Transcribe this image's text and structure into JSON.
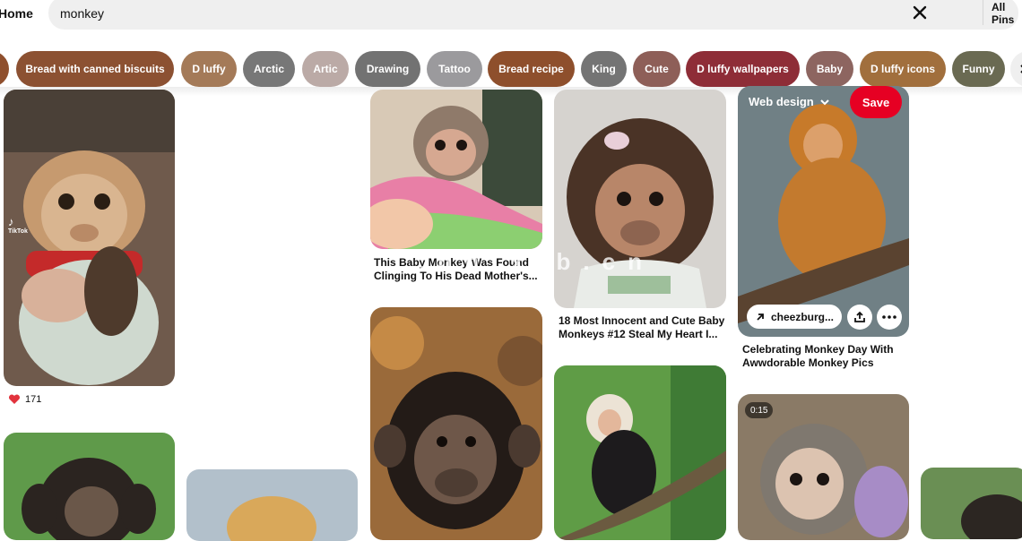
{
  "header": {
    "home_label": "Home",
    "search_value": "monkey",
    "filter_label": "All Pins"
  },
  "chips": [
    {
      "label": "",
      "color": "#8f4f2d"
    },
    {
      "label": "Bread with canned biscuits",
      "color": "#8c5132"
    },
    {
      "label": "D luffy",
      "color": "#a47a58"
    },
    {
      "label": "Arctic",
      "color": "#777777"
    },
    {
      "label": "Artic",
      "color": "#bbaaa6"
    },
    {
      "label": "Drawing",
      "color": "#727272"
    },
    {
      "label": "Tattoo",
      "color": "#9b9a9d"
    },
    {
      "label": "Bread recipe",
      "color": "#8e4f2c"
    },
    {
      "label": "King",
      "color": "#747474"
    },
    {
      "label": "Cute",
      "color": "#8e5f58"
    },
    {
      "label": "D luffy wallpapers",
      "color": "#8e2d37"
    },
    {
      "label": "Baby",
      "color": "#8d6560"
    },
    {
      "label": "D luffy icons",
      "color": "#a16f3d"
    },
    {
      "label": "Funny",
      "color": "#6a6a52"
    }
  ],
  "pins": {
    "col1_top": {
      "reaction_count": "171",
      "tiktok_label": "TikTok"
    },
    "col3_top": {
      "title": "This Baby Monkey Was Found Clinging To His Dead Mother's..."
    },
    "col4_top": {
      "title": "18 Most Innocent and Cute Baby Monkeys #12 Steal My Heart I..."
    },
    "col5_top": {
      "board_label": "Web design",
      "save_label": "Save",
      "link_label": "cheezburg...",
      "title": "Celebrating Monkey Day With Awwdorable Monkey Pics"
    },
    "col5_bottom": {
      "duration": "0:15"
    }
  },
  "watermark": "技艺C...dn.xfb.cn",
  "colors": {
    "save_red": "#e60023",
    "search_bg": "#efefef"
  }
}
